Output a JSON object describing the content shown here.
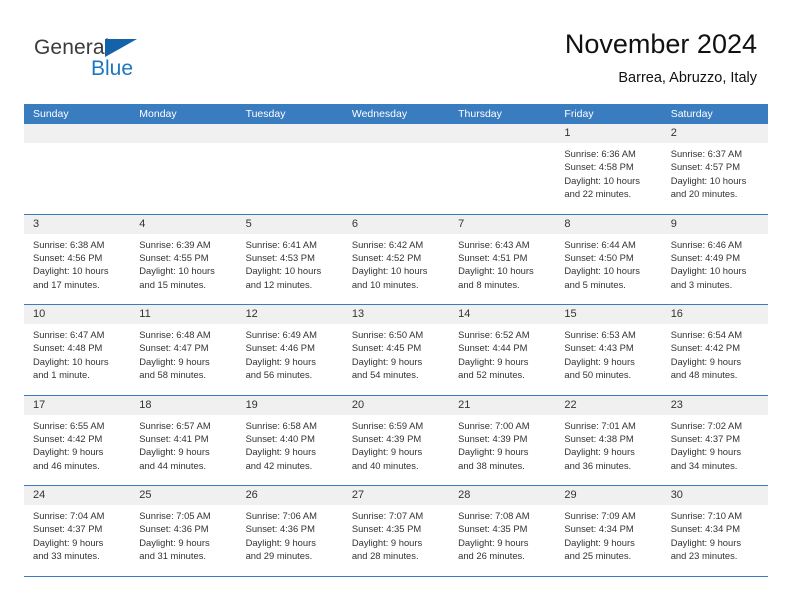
{
  "brand": {
    "name_part1": "General",
    "name_part2": "Blue"
  },
  "header": {
    "title": "November 2024",
    "subtitle": "Barrea, Abruzzo, Italy"
  },
  "colors": {
    "header_blue": "#3a7cc0",
    "brand_blue": "#1d76c4",
    "day_band_gray": "#f0f0f0",
    "text": "#333333"
  },
  "calendar": {
    "weekdays": [
      "Sunday",
      "Monday",
      "Tuesday",
      "Wednesday",
      "Thursday",
      "Friday",
      "Saturday"
    ],
    "weeks": [
      [
        {
          "day": "",
          "lines": []
        },
        {
          "day": "",
          "lines": []
        },
        {
          "day": "",
          "lines": []
        },
        {
          "day": "",
          "lines": []
        },
        {
          "day": "",
          "lines": []
        },
        {
          "day": "1",
          "lines": [
            "Sunrise: 6:36 AM",
            "Sunset: 4:58 PM",
            "Daylight: 10 hours",
            "and 22 minutes."
          ]
        },
        {
          "day": "2",
          "lines": [
            "Sunrise: 6:37 AM",
            "Sunset: 4:57 PM",
            "Daylight: 10 hours",
            "and 20 minutes."
          ]
        }
      ],
      [
        {
          "day": "3",
          "lines": [
            "Sunrise: 6:38 AM",
            "Sunset: 4:56 PM",
            "Daylight: 10 hours",
            "and 17 minutes."
          ]
        },
        {
          "day": "4",
          "lines": [
            "Sunrise: 6:39 AM",
            "Sunset: 4:55 PM",
            "Daylight: 10 hours",
            "and 15 minutes."
          ]
        },
        {
          "day": "5",
          "lines": [
            "Sunrise: 6:41 AM",
            "Sunset: 4:53 PM",
            "Daylight: 10 hours",
            "and 12 minutes."
          ]
        },
        {
          "day": "6",
          "lines": [
            "Sunrise: 6:42 AM",
            "Sunset: 4:52 PM",
            "Daylight: 10 hours",
            "and 10 minutes."
          ]
        },
        {
          "day": "7",
          "lines": [
            "Sunrise: 6:43 AM",
            "Sunset: 4:51 PM",
            "Daylight: 10 hours",
            "and 8 minutes."
          ]
        },
        {
          "day": "8",
          "lines": [
            "Sunrise: 6:44 AM",
            "Sunset: 4:50 PM",
            "Daylight: 10 hours",
            "and 5 minutes."
          ]
        },
        {
          "day": "9",
          "lines": [
            "Sunrise: 6:46 AM",
            "Sunset: 4:49 PM",
            "Daylight: 10 hours",
            "and 3 minutes."
          ]
        }
      ],
      [
        {
          "day": "10",
          "lines": [
            "Sunrise: 6:47 AM",
            "Sunset: 4:48 PM",
            "Daylight: 10 hours",
            "and 1 minute."
          ]
        },
        {
          "day": "11",
          "lines": [
            "Sunrise: 6:48 AM",
            "Sunset: 4:47 PM",
            "Daylight: 9 hours",
            "and 58 minutes."
          ]
        },
        {
          "day": "12",
          "lines": [
            "Sunrise: 6:49 AM",
            "Sunset: 4:46 PM",
            "Daylight: 9 hours",
            "and 56 minutes."
          ]
        },
        {
          "day": "13",
          "lines": [
            "Sunrise: 6:50 AM",
            "Sunset: 4:45 PM",
            "Daylight: 9 hours",
            "and 54 minutes."
          ]
        },
        {
          "day": "14",
          "lines": [
            "Sunrise: 6:52 AM",
            "Sunset: 4:44 PM",
            "Daylight: 9 hours",
            "and 52 minutes."
          ]
        },
        {
          "day": "15",
          "lines": [
            "Sunrise: 6:53 AM",
            "Sunset: 4:43 PM",
            "Daylight: 9 hours",
            "and 50 minutes."
          ]
        },
        {
          "day": "16",
          "lines": [
            "Sunrise: 6:54 AM",
            "Sunset: 4:42 PM",
            "Daylight: 9 hours",
            "and 48 minutes."
          ]
        }
      ],
      [
        {
          "day": "17",
          "lines": [
            "Sunrise: 6:55 AM",
            "Sunset: 4:42 PM",
            "Daylight: 9 hours",
            "and 46 minutes."
          ]
        },
        {
          "day": "18",
          "lines": [
            "Sunrise: 6:57 AM",
            "Sunset: 4:41 PM",
            "Daylight: 9 hours",
            "and 44 minutes."
          ]
        },
        {
          "day": "19",
          "lines": [
            "Sunrise: 6:58 AM",
            "Sunset: 4:40 PM",
            "Daylight: 9 hours",
            "and 42 minutes."
          ]
        },
        {
          "day": "20",
          "lines": [
            "Sunrise: 6:59 AM",
            "Sunset: 4:39 PM",
            "Daylight: 9 hours",
            "and 40 minutes."
          ]
        },
        {
          "day": "21",
          "lines": [
            "Sunrise: 7:00 AM",
            "Sunset: 4:39 PM",
            "Daylight: 9 hours",
            "and 38 minutes."
          ]
        },
        {
          "day": "22",
          "lines": [
            "Sunrise: 7:01 AM",
            "Sunset: 4:38 PM",
            "Daylight: 9 hours",
            "and 36 minutes."
          ]
        },
        {
          "day": "23",
          "lines": [
            "Sunrise: 7:02 AM",
            "Sunset: 4:37 PM",
            "Daylight: 9 hours",
            "and 34 minutes."
          ]
        }
      ],
      [
        {
          "day": "24",
          "lines": [
            "Sunrise: 7:04 AM",
            "Sunset: 4:37 PM",
            "Daylight: 9 hours",
            "and 33 minutes."
          ]
        },
        {
          "day": "25",
          "lines": [
            "Sunrise: 7:05 AM",
            "Sunset: 4:36 PM",
            "Daylight: 9 hours",
            "and 31 minutes."
          ]
        },
        {
          "day": "26",
          "lines": [
            "Sunrise: 7:06 AM",
            "Sunset: 4:36 PM",
            "Daylight: 9 hours",
            "and 29 minutes."
          ]
        },
        {
          "day": "27",
          "lines": [
            "Sunrise: 7:07 AM",
            "Sunset: 4:35 PM",
            "Daylight: 9 hours",
            "and 28 minutes."
          ]
        },
        {
          "day": "28",
          "lines": [
            "Sunrise: 7:08 AM",
            "Sunset: 4:35 PM",
            "Daylight: 9 hours",
            "and 26 minutes."
          ]
        },
        {
          "day": "29",
          "lines": [
            "Sunrise: 7:09 AM",
            "Sunset: 4:34 PM",
            "Daylight: 9 hours",
            "and 25 minutes."
          ]
        },
        {
          "day": "30",
          "lines": [
            "Sunrise: 7:10 AM",
            "Sunset: 4:34 PM",
            "Daylight: 9 hours",
            "and 23 minutes."
          ]
        }
      ]
    ]
  }
}
